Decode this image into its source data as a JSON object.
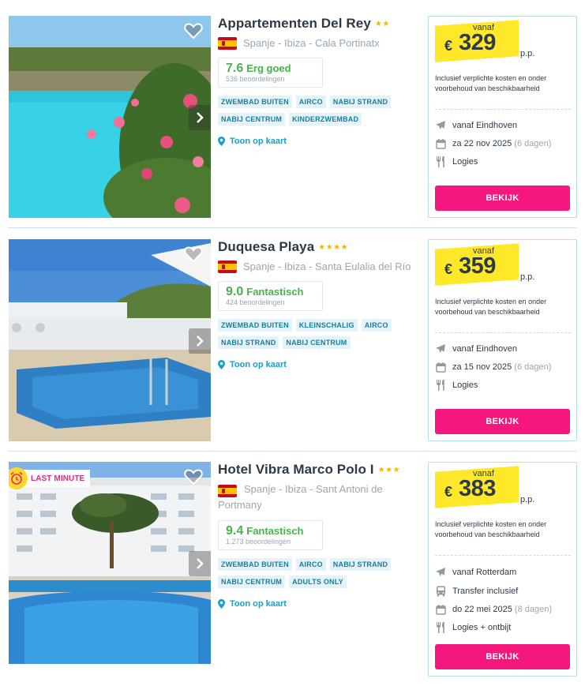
{
  "colors": {
    "accent": "#f4187e",
    "link": "#1aa0c8",
    "rating": "#46b34b",
    "tag_text": "#157fa0",
    "price_highlight": "#ffe82a",
    "star": "#f5b800"
  },
  "icons": {
    "favorite": "heart-outline-icon",
    "next": "chevron-right-icon",
    "map": "map-pin-icon",
    "flight": "plane-icon",
    "transfer": "bus-icon",
    "date": "calendar-icon",
    "board": "fork-knife-icon",
    "last_minute": "alarm-clock-icon",
    "country": "spain-flag-icon"
  },
  "hotels": [
    {
      "name": "Appartementen Del Rey",
      "stars": "★★",
      "location": "Spanje - Ibiza - Cala Portinatx",
      "rating_score": "7.6",
      "rating_label": "Erg goed",
      "rating_count": "536 beoordelingen",
      "tags": [
        "ZWEMBAD BUITEN",
        "AIRCO",
        "NABIJ STRAND",
        "NABIJ CENTRUM",
        "KINDERZWEMBAD"
      ],
      "map_label": "Toon op kaart",
      "price_from": "vanaf",
      "currency": "€",
      "price": "329",
      "per_person": "p.p.",
      "incl_text": "Inclusief verplichte kosten en onder voorbehoud van beschikbaarheid",
      "departure": "vanaf Eindhoven",
      "date": "za 22 nov 2025",
      "duration": "(6 dagen)",
      "board": "Logies",
      "cta": "BEKIJK"
    },
    {
      "name": "Duquesa Playa",
      "stars": "★★★★",
      "location": "Spanje - Ibiza - Santa Eulalia del Río",
      "rating_score": "9.0",
      "rating_label": "Fantastisch",
      "rating_count": "424 beoordelingen",
      "tags": [
        "ZWEMBAD BUITEN",
        "KLEINSCHALIG",
        "AIRCO",
        "NABIJ STRAND",
        "NABIJ CENTRUM"
      ],
      "map_label": "Toon op kaart",
      "price_from": "vanaf",
      "currency": "€",
      "price": "359",
      "per_person": "p.p.",
      "incl_text": "Inclusief verplichte kosten en onder voorbehoud van beschikbaarheid",
      "departure": "vanaf Eindhoven",
      "date": "za 15 nov 2025",
      "duration": "(6 dagen)",
      "board": "Logies",
      "cta": "BEKIJK"
    },
    {
      "name": "Hotel Vibra Marco Polo I",
      "stars": "★★★",
      "badge": "LAST MINUTE",
      "location": "Spanje - Ibiza - Sant Antoni de Portmany",
      "rating_score": "9.4",
      "rating_label": "Fantastisch",
      "rating_count": "1.273 beoordelingen",
      "tags": [
        "ZWEMBAD BUITEN",
        "AIRCO",
        "NABIJ STRAND",
        "NABIJ CENTRUM",
        "ADULTS ONLY"
      ],
      "map_label": "Toon op kaart",
      "price_from": "vanaf",
      "currency": "€",
      "price": "383",
      "per_person": "p.p.",
      "incl_text": "Inclusief verplichte kosten en onder voorbehoud van beschikbaarheid",
      "departure": "vanaf Rotterdam",
      "transfer": "Transfer inclusief",
      "date": "do 22 mei 2025",
      "duration": "(8 dagen)",
      "board": "Logies + ontbijt",
      "cta": "BEKIJK"
    }
  ]
}
